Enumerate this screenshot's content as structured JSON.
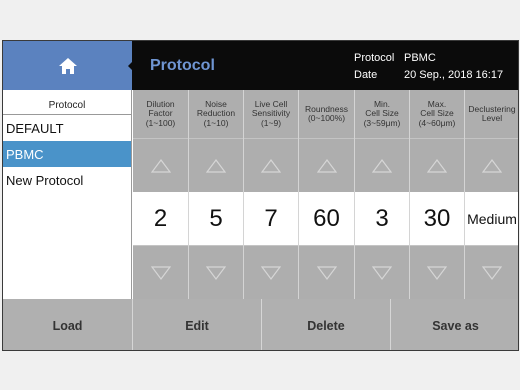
{
  "header": {
    "title": "Protocol",
    "protocol_key": "Protocol",
    "protocol_value": "PBMC",
    "date_key": "Date",
    "date_value": "20 Sep., 2018 16:17"
  },
  "sidebar": {
    "heading": "Protocol",
    "items": [
      {
        "label": "DEFAULT",
        "selected": false
      },
      {
        "label": "PBMC",
        "selected": true
      },
      {
        "label": "New Protocol",
        "selected": false
      }
    ]
  },
  "params": [
    {
      "l1": "Dilution",
      "l2": "Factor",
      "l3": "(1~100)",
      "value": "2"
    },
    {
      "l1": "Noise",
      "l2": "Reduction",
      "l3": "(1~10)",
      "value": "5"
    },
    {
      "l1": "Live Cell",
      "l2": "Sensitivity",
      "l3": "(1~9)",
      "value": "7"
    },
    {
      "l1": "Roundness",
      "l2": "(0~100%)",
      "l3": "",
      "value": "60"
    },
    {
      "l1": "Min.",
      "l2": "Cell Size",
      "l3": "(3~59μm)",
      "value": "3"
    },
    {
      "l1": "Max.",
      "l2": "Cell Size",
      "l3": "(4~60μm)",
      "value": "30"
    },
    {
      "l1": "Declustering",
      "l2": "Level",
      "l3": "",
      "value": "Medium"
    }
  ],
  "buttons": {
    "load": "Load",
    "edit": "Edit",
    "delete": "Delete",
    "save_as": "Save as"
  },
  "colors": {
    "accent": "#5b82bf",
    "selection": "#4a93c9",
    "title": "#6f95d2"
  },
  "icons": {
    "home": "home-icon",
    "up": "triangle-up-icon",
    "down": "triangle-down-icon"
  }
}
